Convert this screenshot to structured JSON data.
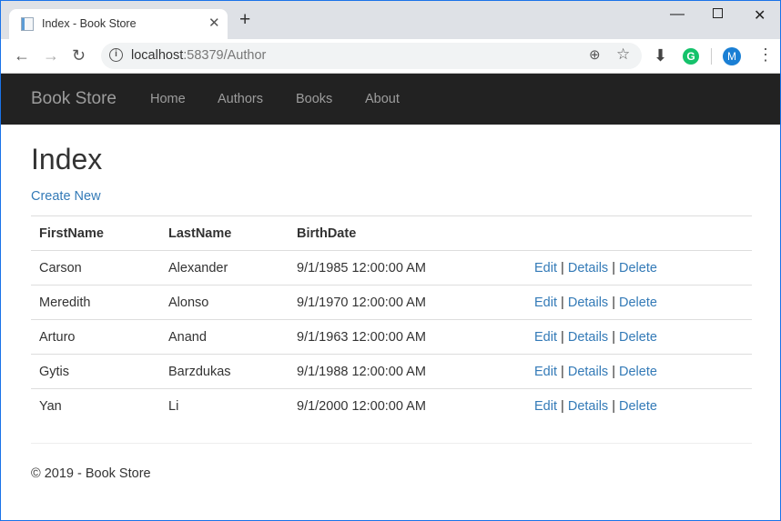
{
  "browser": {
    "tab_title": "Index - Book Store",
    "url_host": "localhost",
    "url_rest": ":58379/Author",
    "profile_initial": "M"
  },
  "nav": {
    "brand": "Book Store",
    "links": [
      "Home",
      "Authors",
      "Books",
      "About"
    ]
  },
  "page": {
    "title": "Index",
    "create_new": "Create New"
  },
  "table": {
    "headers": [
      "FirstName",
      "LastName",
      "BirthDate",
      ""
    ],
    "rows": [
      {
        "first": "Carson",
        "last": "Alexander",
        "birth": "9/1/1985 12:00:00 AM"
      },
      {
        "first": "Meredith",
        "last": "Alonso",
        "birth": "9/1/1970 12:00:00 AM"
      },
      {
        "first": "Arturo",
        "last": "Anand",
        "birth": "9/1/1963 12:00:00 AM"
      },
      {
        "first": "Gytis",
        "last": "Barzdukas",
        "birth": "9/1/1988 12:00:00 AM"
      },
      {
        "first": "Yan",
        "last": "Li",
        "birth": "9/1/2000 12:00:00 AM"
      }
    ],
    "actions": {
      "edit": "Edit",
      "details": "Details",
      "delete": "Delete",
      "sep": "|"
    }
  },
  "footer": "© 2019 - Book Store"
}
